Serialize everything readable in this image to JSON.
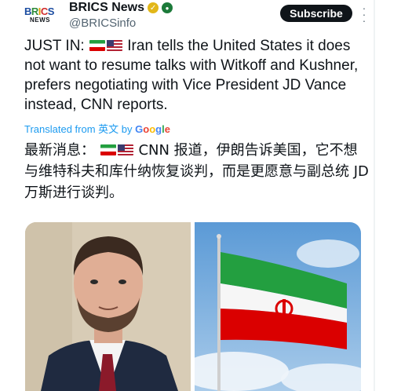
{
  "author": {
    "logo_text": "BRICS",
    "logo_subtext": "NEWS",
    "display_name": "BRICS News",
    "handle": "@BRICSinfo"
  },
  "actions": {
    "subscribe_label": "Subscribe",
    "more_icon": "more-vertical-icon"
  },
  "tweet": {
    "prefix": "JUST IN: ",
    "text": " Iran tells the United States it does not want to resume talks with Witkoff and Kushner, prefers negotiating with Vice President JD Vance instead, CNN reports.",
    "translated_label": "Translated from 英文 by ",
    "translated_by": "Google",
    "translation_prefix": "最新消息：",
    "translation_text": " CNN 报道，伊朗告诉美国，它不想与维特科夫和库什纳恢复谈判，而是更愿意与副总统 JD 万斯进行谈判。"
  },
  "colors": {
    "link_blue": "#1d9bf0",
    "verified_gold": "#e2b719",
    "subscribe_bg": "#0f1419"
  }
}
